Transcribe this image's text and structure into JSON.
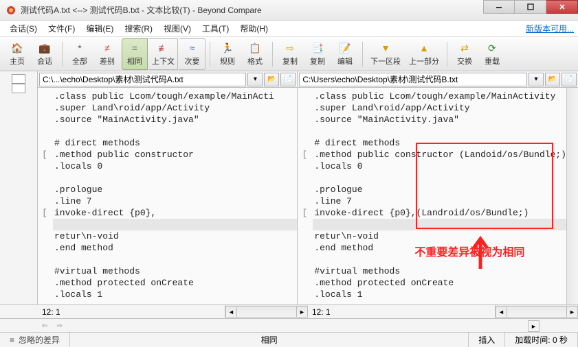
{
  "window": {
    "title": "测试代码A.txt <--> 测试代码B.txt - 文本比较(T) - Beyond Compare"
  },
  "menu": {
    "session": "会话(S)",
    "file": "文件(F)",
    "edit": "编辑(E)",
    "search": "搜索(R)",
    "view": "视图(V)",
    "tools": "工具(T)",
    "help": "帮助(H)",
    "update": "新版本可用..."
  },
  "toolbar": {
    "home": "主页",
    "sessions": "会话",
    "all": "全部",
    "diff": "差别",
    "same": "相同",
    "context": "上下文",
    "minor": "次要",
    "rules": "规则",
    "format": "格式",
    "copyL": "复制",
    "copyR": "复制",
    "editBtn": "编辑",
    "nextSec": "下一区段",
    "prevPart": "上一部分",
    "swap": "交换",
    "reload": "重载"
  },
  "paths": {
    "left": "C:\\...\\echo\\Desktop\\素材\\测试代码A.txt",
    "right": "C:\\Users\\echo\\Desktop\\素材\\测试代码B.txt"
  },
  "left_lines": [
    ".class public Lcom/tough/example/MainActi",
    ".super Land\\roid/app/Activity",
    ".source \"MainActivity.java\"",
    "",
    "# direct methods",
    ".method public constructor",
    ".locals 0",
    "",
    ".prologue",
    ".line 7",
    "invoke-direct {p0},",
    "GAP",
    "retur\\n-void",
    ".end method",
    "",
    "#virtual methods",
    ".method protected onCreate",
    ".locals 1"
  ],
  "right_lines": [
    ".class public Lcom/tough/example/MainActivity",
    ".super Land\\roid/app/Activity",
    ".source \"MainActivity.java\"",
    "",
    "# direct methods",
    ".method public constructor (Landoid/os/Bundle;)",
    ".locals 0",
    "",
    ".prologue",
    ".line 7",
    "invoke-direct {p0},(Landroid/os/Bundle;)",
    "GAP",
    "retur\\n-void",
    ".end method",
    "",
    "#virtual methods",
    ".method protected onCreate",
    ".locals 1"
  ],
  "left_marks": [
    "",
    "",
    "",
    "",
    "",
    "[",
    "",
    "",
    "",
    "",
    "[",
    "",
    "",
    "",
    "",
    "",
    "",
    ""
  ],
  "right_marks": [
    "",
    "",
    "",
    "",
    "",
    "[",
    "",
    "",
    "",
    "",
    "[",
    "",
    "",
    "",
    "",
    "",
    "",
    ""
  ],
  "status": {
    "leftpos": "12: 1",
    "rightpos": "12: 1"
  },
  "bottom": {
    "ignored": "忽略的差异",
    "same": "相同",
    "insert": "插入",
    "load": "加载时间:",
    "loadval": "0 秒"
  },
  "annotation": "不重要差异被视为相同"
}
